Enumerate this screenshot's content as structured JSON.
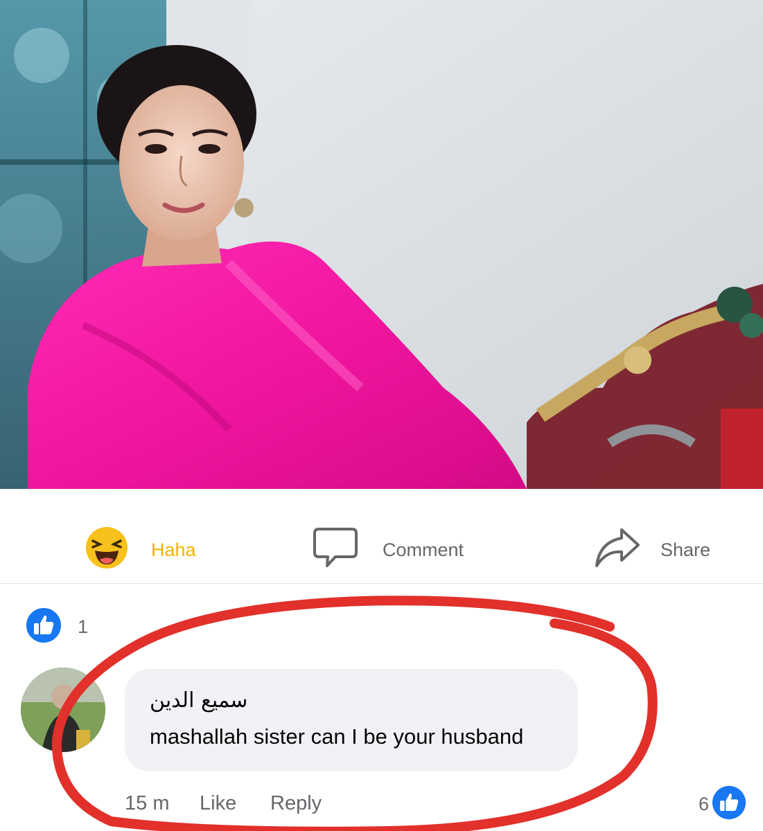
{
  "post": {
    "photo_alt": "post-photo"
  },
  "actions": {
    "haha_label": "Haha",
    "comment_label": "Comment",
    "share_label": "Share"
  },
  "reactions": {
    "count": "1"
  },
  "comment": {
    "author": "سميع الدين",
    "text": "mashallah sister can I be your husband",
    "time": "15 m",
    "like_label": "Like",
    "reply_label": "Reply",
    "like_count": "6"
  },
  "colors": {
    "haha": "#f3b300",
    "facebook_blue": "#1877f2",
    "annotation_red": "#e2302a",
    "scarf_pink": "#f0169f"
  },
  "icons": [
    "haha-emoji-icon",
    "comment-icon",
    "share-icon",
    "like-thumb-icon"
  ]
}
